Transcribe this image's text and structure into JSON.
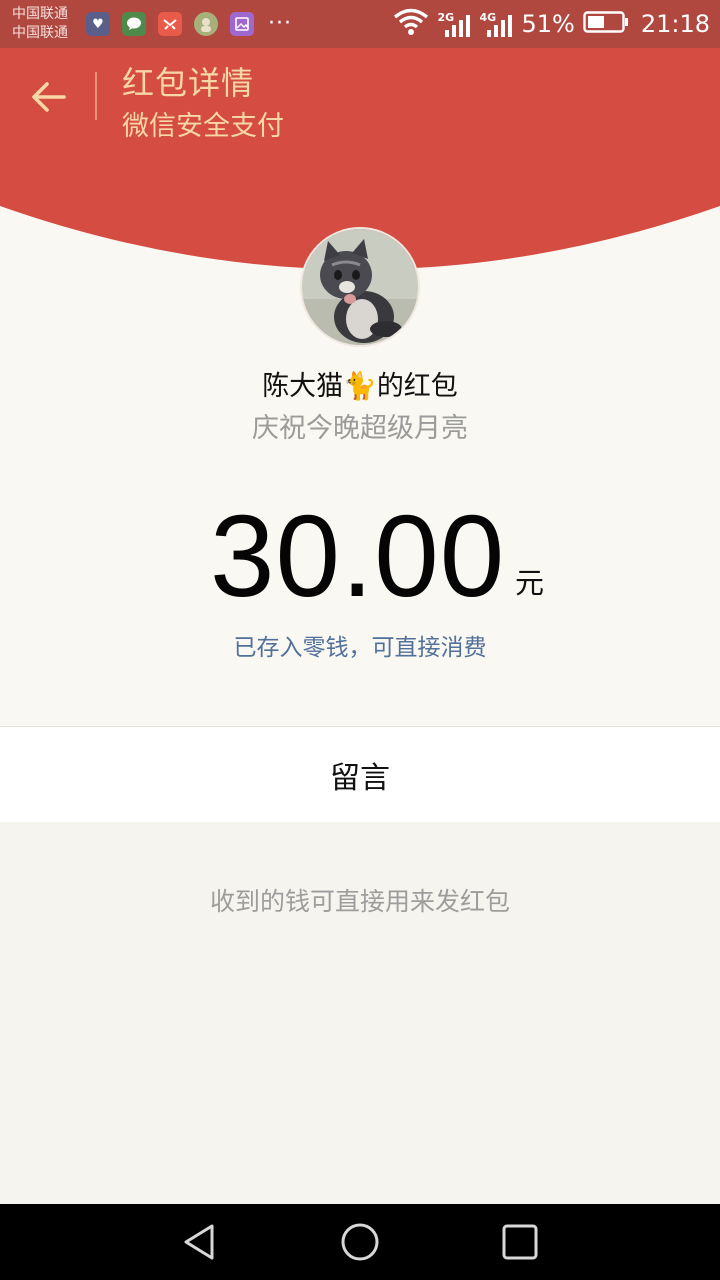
{
  "status_bar": {
    "carrier_1": "中国联通",
    "carrier_2": "中国联通",
    "notification_icons": [
      "health-app-icon",
      "wechat-icon",
      "mail-app-icon",
      "avatar-app-icon",
      "gallery-icon"
    ],
    "more": "···",
    "signal_1_tag": "2G",
    "signal_2_tag": "4G",
    "battery_percent": "51%",
    "battery_level": 0.51,
    "time": "21:18"
  },
  "header": {
    "title": "红包详情",
    "subtitle": "微信安全支付",
    "back_icon": "arrow-left-icon",
    "background_color": "#d54c43",
    "text_color": "#f7d7a6"
  },
  "envelope": {
    "sender_line_before": "陈大猫",
    "sender_emoji": "🐈",
    "sender_line_after": "的红包",
    "blessing": "庆祝今晚超级月亮",
    "amount": "30.00",
    "unit": "元",
    "stored_note": "已存入零钱，可直接消费"
  },
  "message": {
    "label": "留言"
  },
  "footer": {
    "hint": "收到的钱可直接用来发红包"
  },
  "nav_bar": {
    "icons": [
      "nav-back-icon",
      "nav-home-icon",
      "nav-recent-icon"
    ]
  }
}
